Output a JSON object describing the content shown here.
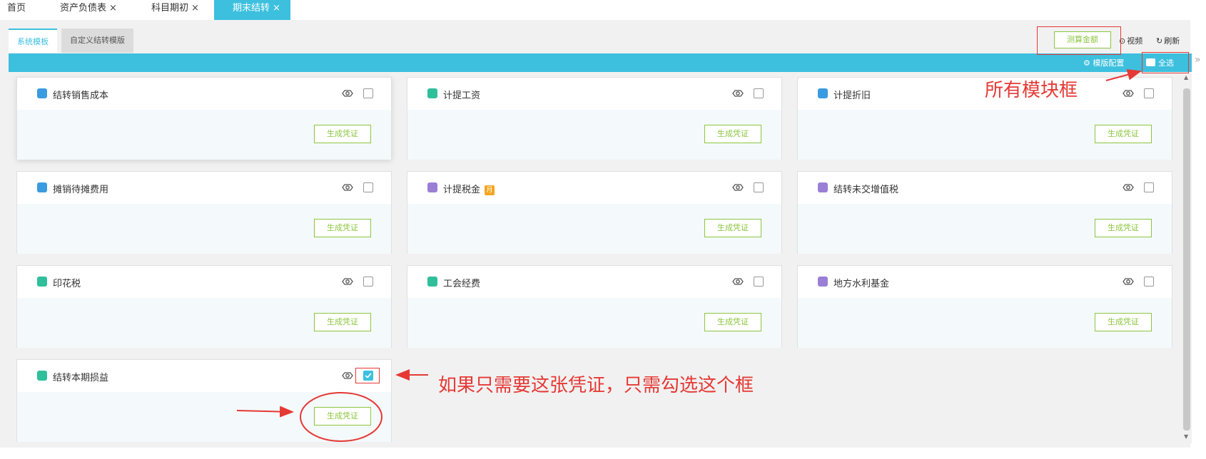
{
  "top_tabs": [
    {
      "label": "首页",
      "closable": false
    },
    {
      "label": "资产负债表",
      "closable": true
    },
    {
      "label": "科目期初",
      "closable": true
    },
    {
      "label": "期末结转",
      "closable": true,
      "active": true
    }
  ],
  "close_glyph": "×",
  "subtabs": [
    "系统模板",
    "自定义结转模版"
  ],
  "toolbar": {
    "measure_button": "测算金额",
    "video": "视频",
    "refresh": "刷新"
  },
  "bar": {
    "template_config": "模版配置",
    "select_all": "全选"
  },
  "generate_label": "生成凭证",
  "cards": [
    {
      "title": "结转销售成本",
      "icon": "coin-icon",
      "icon_color": "#3a9be0",
      "checked": false
    },
    {
      "title": "计提工资",
      "icon": "wage-icon",
      "icon_color": "#2fbf9a",
      "checked": false
    },
    {
      "title": "计提折旧",
      "icon": "depreciation-icon",
      "icon_color": "#3a9be0",
      "checked": false
    },
    {
      "title": "摊销待摊费用",
      "icon": "grid-icon",
      "icon_color": "#3a9be0",
      "checked": false
    },
    {
      "title": "计提税金",
      "icon": "tax-stack-icon",
      "icon_color": "#9b7fd6",
      "checked": false,
      "badge": "月"
    },
    {
      "title": "结转未交增值税",
      "icon": "vat-icon",
      "icon_color": "#9b7fd6",
      "checked": false
    },
    {
      "title": "印花税",
      "icon": "stamp-icon",
      "icon_color": "#2fbf9a",
      "checked": false
    },
    {
      "title": "工会经费",
      "icon": "union-icon",
      "icon_color": "#2fbf9a",
      "checked": false
    },
    {
      "title": "地方水利基金",
      "icon": "fund-icon",
      "icon_color": "#9b7fd6",
      "checked": false
    },
    {
      "title": "结转本期损益",
      "icon": "profit-loss-icon",
      "icon_color": "#2fbf9a",
      "checked": true
    }
  ],
  "annotations": {
    "all_modules": "所有模块框",
    "only_this": "如果只需要这张凭证，只需勾选这个框"
  },
  "colors": {
    "accent": "#3cc0de",
    "green": "#8cc63f",
    "annotation": "#e53935"
  }
}
